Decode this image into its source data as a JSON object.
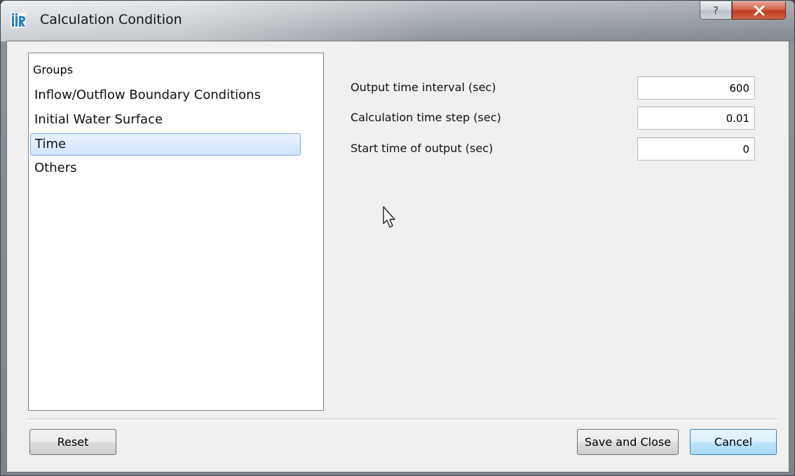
{
  "window": {
    "title": "Calculation Condition"
  },
  "titlebar_buttons": {
    "help": "?"
  },
  "groups": {
    "header": "Groups",
    "items": [
      {
        "label": "Inflow/Outflow Boundary Conditions",
        "selected": false
      },
      {
        "label": "Initial Water Surface",
        "selected": false
      },
      {
        "label": "Time",
        "selected": true
      },
      {
        "label": "Others",
        "selected": false
      }
    ]
  },
  "form": {
    "fields": [
      {
        "label": "Output time interval (sec)",
        "value": "600"
      },
      {
        "label": "Calculation time step (sec)",
        "value": "0.01"
      },
      {
        "label": "Start time of output (sec)",
        "value": "0"
      }
    ]
  },
  "buttons": {
    "reset": "Reset",
    "save_and_close": "Save and Close",
    "cancel": "Cancel"
  },
  "colors": {
    "selection_fill": "#cfe4fb",
    "selection_border": "#84acdd",
    "close_button": "#c0391f"
  },
  "icons": {
    "app": "iric-app-icon",
    "close": "close-icon",
    "cursor": "mouse-pointer-icon"
  }
}
